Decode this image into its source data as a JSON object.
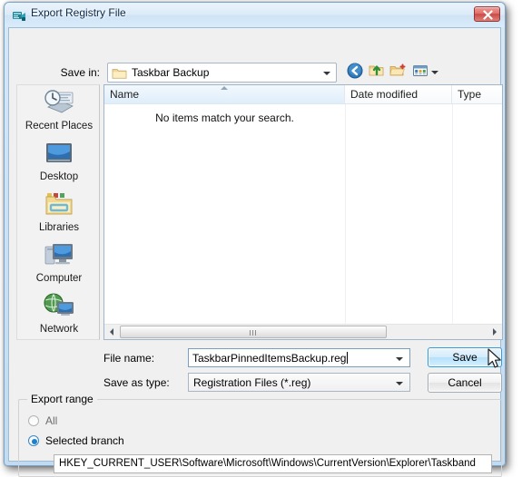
{
  "window": {
    "title": "Export Registry File",
    "title_icon": "registry-editor-icon",
    "close_label": "x",
    "accent_blue": "#3c9ad3",
    "frame_color": "#cfe2f4",
    "close_red": "#ca4b46"
  },
  "savein": {
    "label": "Save in:",
    "value": "Taskbar Backup",
    "folder_icon": "folder-icon",
    "dropdown_icon": "chevron-down-icon"
  },
  "toolbar": {
    "back_icon": "back-arrow-icon",
    "up_icon": "up-one-level-icon",
    "new_folder_icon": "new-folder-icon",
    "views_icon": "views-icon",
    "views_arrow_icon": "chevron-down-icon"
  },
  "places": {
    "items": [
      {
        "label": "Recent Places",
        "icon": "recent-places-icon"
      },
      {
        "label": "Desktop",
        "icon": "desktop-icon"
      },
      {
        "label": "Libraries",
        "icon": "libraries-icon"
      },
      {
        "label": "Computer",
        "icon": "computer-icon"
      },
      {
        "label": "Network",
        "icon": "network-icon"
      }
    ]
  },
  "filelist": {
    "columns": [
      {
        "label": "Name",
        "sorted": "ascending"
      },
      {
        "label": "Date modified"
      },
      {
        "label": "Type"
      }
    ],
    "empty_message": "No items match your search.",
    "rows": [],
    "sort_icon": "sort-ascending-icon",
    "scrollbar": {
      "left_icon": "scroll-left-icon",
      "right_icon": "scroll-right-icon",
      "grip_icon": "scroll-grip-icon"
    }
  },
  "form": {
    "filename_label": "File name:",
    "filename_value": "TaskbarPinnedItemsBackup.reg",
    "filetype_label": "Save as type:",
    "filetype_value": "Registration Files (*.reg)",
    "dropdown_icon": "chevron-down-icon"
  },
  "buttons": {
    "save": "Save",
    "cancel": "Cancel",
    "save_state": "hovered",
    "cursor_icon": "mouse-pointer-icon"
  },
  "export_range": {
    "legend": "Export range",
    "options": [
      {
        "label": "All",
        "selected": false
      },
      {
        "label": "Selected branch",
        "selected": true
      }
    ],
    "branch_path": "HKEY_CURRENT_USER\\Software\\Microsoft\\Windows\\CurrentVersion\\Explorer\\Taskband"
  }
}
